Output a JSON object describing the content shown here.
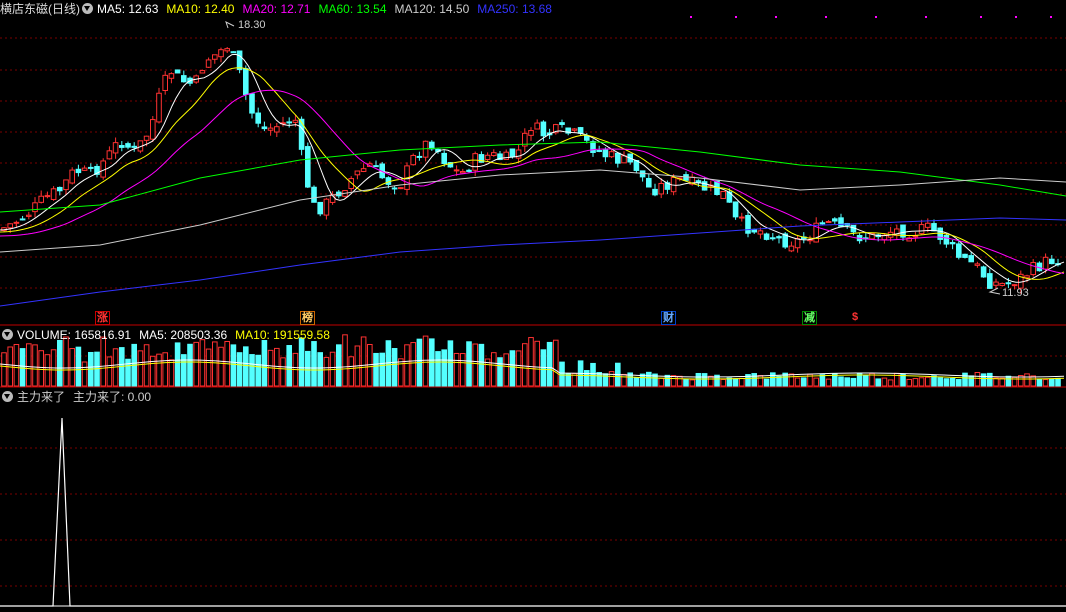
{
  "stock": {
    "name": "横店东磁",
    "period": "(日线)"
  },
  "price_legend": [
    {
      "label": "MA5: 12.63",
      "color": "#ffffff"
    },
    {
      "label": "MA10: 12.40",
      "color": "#ffff00"
    },
    {
      "label": "MA20: 12.71",
      "color": "#ff00ff"
    },
    {
      "label": "MA60: 13.54",
      "color": "#00ff00"
    },
    {
      "label": "MA120: 14.50",
      "color": "#cccccc"
    },
    {
      "label": "MA250: 13.68",
      "color": "#3333ff"
    }
  ],
  "price_high_label": "18.30",
  "price_low_label": "11.93",
  "event_markers": [
    {
      "text": "涨",
      "color": "#ff3333",
      "box": "#cc0000"
    },
    {
      "text": "榜",
      "color": "#ffcc66",
      "box": "#cc6600"
    },
    {
      "text": "财",
      "color": "#66aaff",
      "box": "#0044cc"
    },
    {
      "text": "减",
      "color": "#66ff66",
      "box": "#008800"
    },
    {
      "text": "$",
      "color": "#ff3333",
      "box": ""
    }
  ],
  "volume_legend": [
    {
      "label": "VOLUME: 165816.91",
      "color": "#ffffff"
    },
    {
      "label": "MA5: 208503.36",
      "color": "#ffffff"
    },
    {
      "label": "MA10: 191559.58",
      "color": "#ffff00"
    }
  ],
  "indicator_legend": [
    {
      "label": "主力来了",
      "color": "#ffffff"
    },
    {
      "label": "主力来了: 0.00",
      "color": "#ffffff"
    }
  ],
  "colors": {
    "up": "#ff3232",
    "down": "#54ffff",
    "grid": "#7a0000",
    "divider": "#c00000"
  }
}
